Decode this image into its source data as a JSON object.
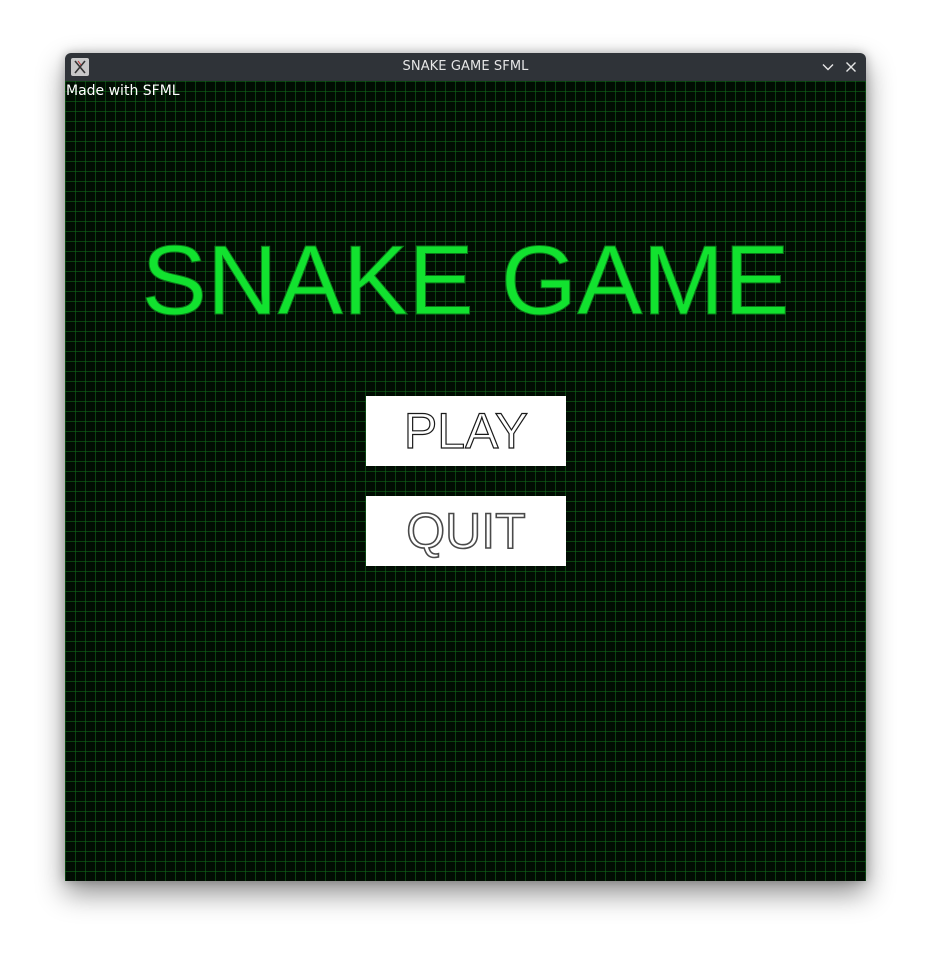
{
  "window": {
    "title": "SNAKE GAME SFML",
    "icons": {
      "app": "x11-app-icon",
      "minimize": "chevron-down-icon",
      "close": "close-icon"
    }
  },
  "game": {
    "credit": "Made with SFML",
    "title": "SNAKE GAME",
    "menu": {
      "play_label": "PLAY",
      "quit_label": "QUIT"
    }
  },
  "colors": {
    "title_green": "#12e22f",
    "background": "#010d03",
    "grid_line": "#126e1c",
    "titlebar": "#2f3338",
    "button_bg": "#ffffff"
  }
}
